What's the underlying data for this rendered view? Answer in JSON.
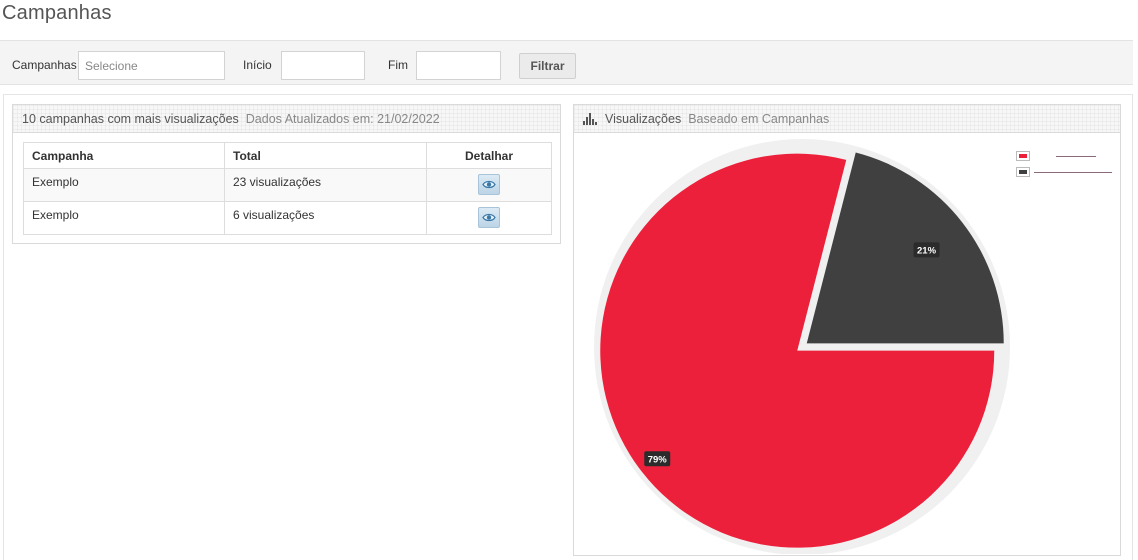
{
  "page": {
    "title": "Campanhas"
  },
  "filters": {
    "campanhas_label": "Campanhas",
    "campanhas_placeholder": "Selecione",
    "inicio_label": "Início",
    "fim_label": "Fim",
    "filtrar_label": "Filtrar"
  },
  "top10": {
    "title": "10 campanhas com mais visualizações",
    "subtitle": "Dados Atualizados em: 21/02/2022",
    "columns": [
      "Campanha",
      "Total",
      "Detalhar"
    ],
    "rows": [
      {
        "campanha": "Exemplo",
        "total": "23 visualizações"
      },
      {
        "campanha": "Exemplo",
        "total": "6 visualizações"
      }
    ]
  },
  "chart_widget": {
    "title": "Visualizações",
    "subtitle": "Baseado em Campanhas",
    "icon": "bar-chart-icon"
  },
  "chart_data": {
    "type": "pie",
    "slices": [
      {
        "label": "",
        "value": 79,
        "display": "79%",
        "color": "#ec203b"
      },
      {
        "label": "",
        "value": 21,
        "display": "21%",
        "color": "#404040"
      }
    ],
    "legend_position": "top-right"
  }
}
